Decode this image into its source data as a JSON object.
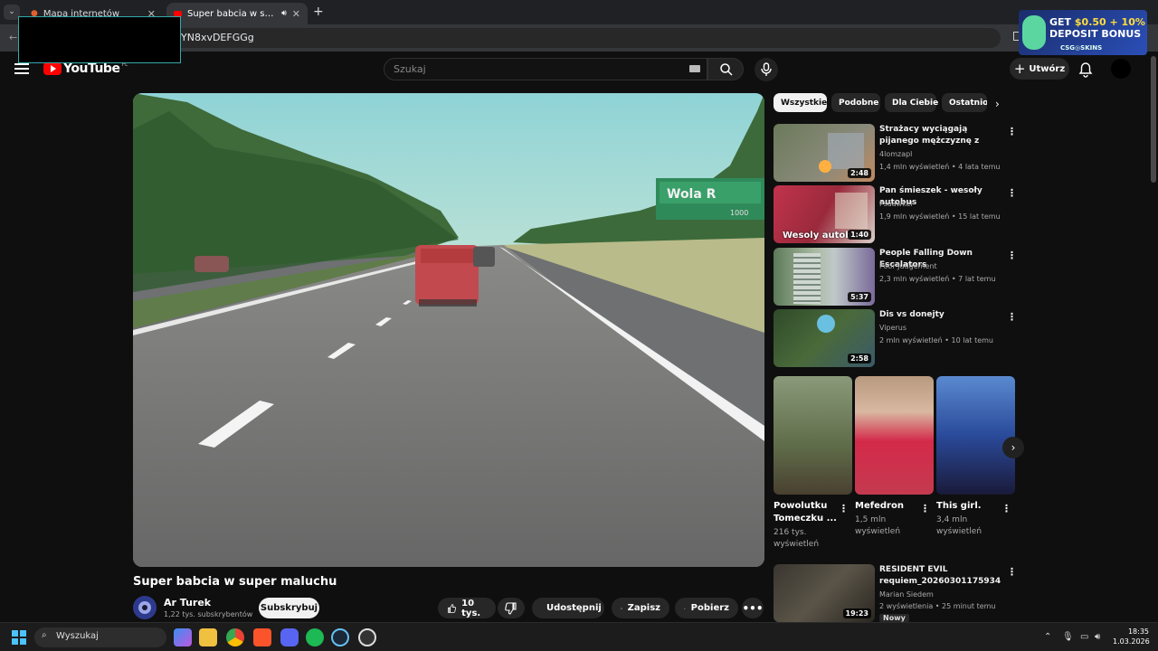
{
  "browser": {
    "tabs": [
      {
        "title": "Mapa internetów"
      },
      {
        "title": "Super babcia w super maluchu"
      }
    ],
    "url": "YN8xvDEFGGg"
  },
  "ad": {
    "line1a": "GET ",
    "line1b": "$0.50 + 10%",
    "line2": "DEPOSIT BONUS",
    "brand": "CSG◎SKINS"
  },
  "header": {
    "logo_text": "YouTube",
    "country": "PL",
    "search_placeholder": "Szukaj",
    "create_label": "Utwórz"
  },
  "video": {
    "title": "Super babcia w super maluchu",
    "sign_text": "Wola R",
    "sign_sub": "1000"
  },
  "channel": {
    "name": "Ar Turek",
    "subs": "1,22 tys. subskrybentów",
    "subscribe_label": "Subskrybuj"
  },
  "actions": {
    "likes": "10 tys.",
    "share": "Udostępnij",
    "save": "Zapisz",
    "download": "Pobierz"
  },
  "chips": [
    "Wszystkie",
    "Podobne",
    "Dla Ciebie",
    "Ostatnio"
  ],
  "recs": [
    {
      "title": "Strażacy wyciągają pijanego mężczyznę z kontenera na ...",
      "channel": "4lomzapl",
      "meta": "1,4 mln wyświetleń • 4 lata temu",
      "duration": "2:48",
      "color": "#5d6a4e"
    },
    {
      "title": "Pan śmieszek - wesoły autobus",
      "channel": "Psaawkel",
      "meta": "1,9 mln wyświetleń • 15 lat temu",
      "duration": "1:40",
      "overlay": "Wesoly autobus",
      "color": "#b8334a"
    },
    {
      "title": "People Falling Down Escalators",
      "channel": "Poor Judgement",
      "meta": "2,3 mln wyświetleń • 7 lat temu",
      "duration": "5:37",
      "color": "#7d8a7b"
    },
    {
      "title": "Dis vs donejty",
      "channel": "Viperus",
      "meta": "2 mln wyświetleń • 10 lat temu",
      "duration": "2:58",
      "color": "#3e5e35"
    }
  ],
  "shorts": [
    {
      "title": "Powolutku Tomeczku ...",
      "views": "216 tys. wyświetleń",
      "color": "#5e6b48"
    },
    {
      "title": "Mefedron",
      "views": "1,5 mln wyświetleń",
      "color": "#c43a4f"
    },
    {
      "title": "This girl.",
      "views": "3,4 mln wyświetleń",
      "color": "#3c5b95"
    }
  ],
  "last_rec": {
    "title": "RESIDENT EVIL requiem_20260301175934",
    "channel": "Marian Siedem",
    "meta": "2 wyświetlenia • 25 minut temu",
    "badge": "Nowy",
    "duration": "19:23"
  },
  "taskbar": {
    "search_placeholder": "Wyszukaj",
    "time": "18:35",
    "date": "1.03.2026"
  }
}
